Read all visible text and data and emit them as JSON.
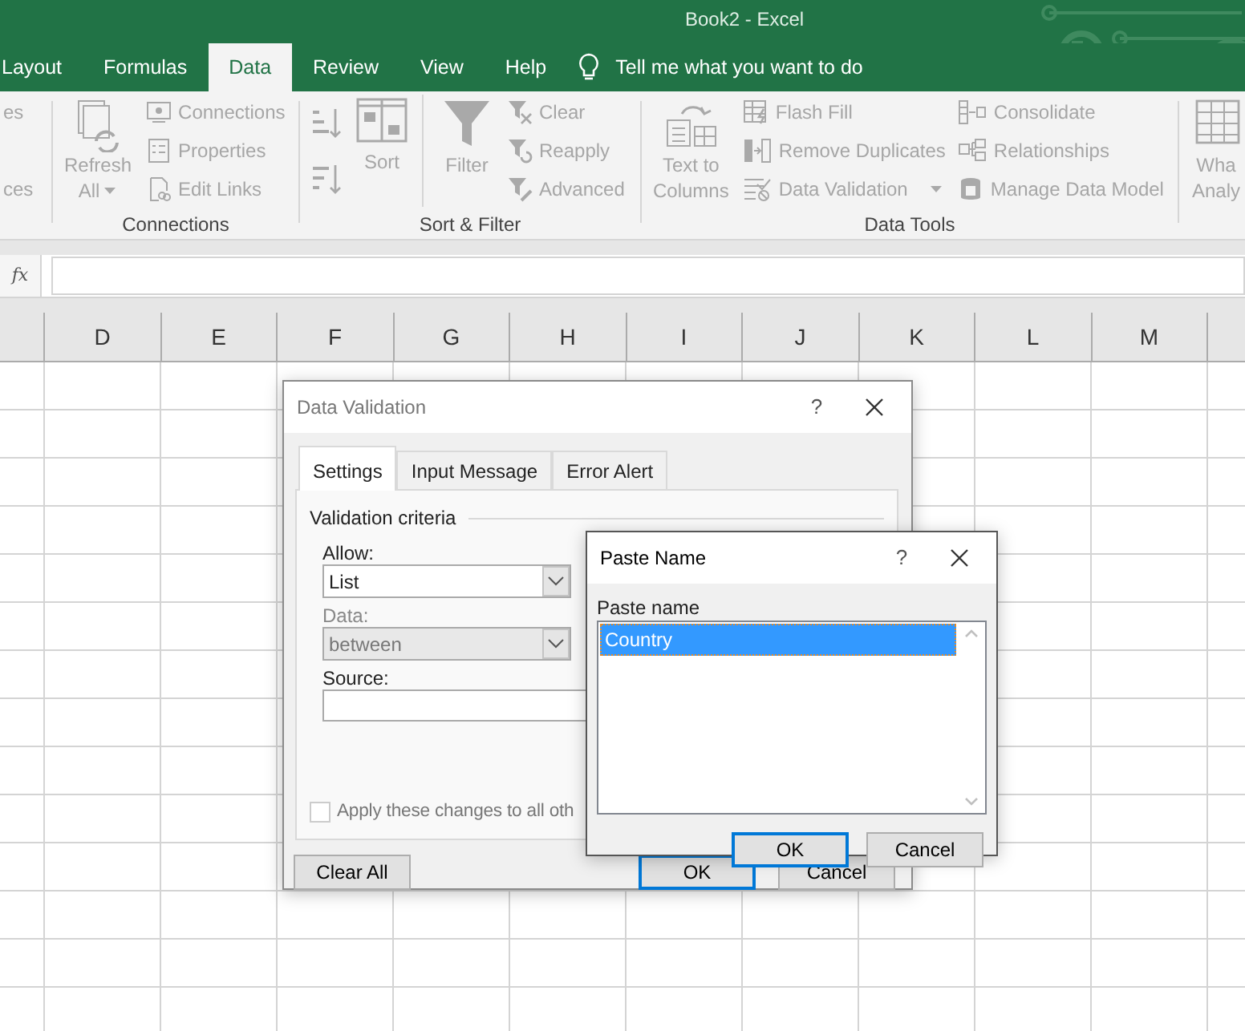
{
  "window": {
    "title": "Book2  -  Excel"
  },
  "ribbon_tabs": [
    {
      "label": "Layout",
      "selected": false
    },
    {
      "label": "Formulas",
      "selected": false
    },
    {
      "label": "Data",
      "selected": true
    },
    {
      "label": "Review",
      "selected": false
    },
    {
      "label": "View",
      "selected": false
    },
    {
      "label": "Help",
      "selected": false
    }
  ],
  "tell_me": {
    "label": "Tell me what you want to do"
  },
  "ribbon": {
    "disabled": true,
    "groups": [
      {
        "columns": [
          [
            {
              "kind": "small",
              "label": "es"
            },
            {
              "kind": "small",
              "label": "ces"
            }
          ]
        ]
      },
      {
        "label": "Connections",
        "columns": [
          [
            {
              "kind": "large",
              "lines": [
                "Refresh",
                "All"
              ],
              "dropdown": true
            }
          ],
          [
            {
              "kind": "small",
              "label": "Connections"
            },
            {
              "kind": "small",
              "label": "Properties"
            },
            {
              "kind": "small",
              "label": "Edit Links"
            }
          ]
        ]
      },
      {
        "label": "Sort & Filter",
        "columns": [
          [
            {
              "kind": "icon"
            },
            {
              "kind": "icon"
            }
          ],
          [
            {
              "kind": "large",
              "lines": [
                "Sort"
              ]
            }
          ],
          [
            {
              "kind": "large",
              "lines": [
                "Filter"
              ]
            }
          ],
          [
            {
              "kind": "small",
              "label": "Clear"
            },
            {
              "kind": "small",
              "label": "Reapply"
            },
            {
              "kind": "small",
              "label": "Advanced"
            }
          ]
        ]
      },
      {
        "label": "Data Tools",
        "columns": [
          [
            {
              "kind": "large",
              "lines": [
                "Text to",
                "Columns"
              ]
            }
          ],
          [
            {
              "kind": "small",
              "label": "Flash Fill"
            },
            {
              "kind": "small",
              "label": "Remove Duplicates"
            },
            {
              "kind": "small",
              "label": "Data Validation",
              "dropdown": true
            }
          ],
          [
            {
              "kind": "small",
              "label": "Consolidate"
            },
            {
              "kind": "small",
              "label": "Relationships"
            },
            {
              "kind": "small",
              "label": "Manage Data Model"
            }
          ]
        ]
      },
      {
        "columns": [
          [
            {
              "kind": "large",
              "lines": [
                "Wha",
                "Analy"
              ]
            }
          ]
        ]
      }
    ]
  },
  "formula_bar": {
    "function_label": "fx"
  },
  "columns": [
    "D",
    "E",
    "F",
    "G",
    "H",
    "I",
    "J",
    "K",
    "L",
    "M"
  ],
  "data_validation": {
    "title": "Data Validation",
    "help": "?",
    "tabs": [
      {
        "label": "Settings",
        "selected": true
      },
      {
        "label": "Input Message",
        "selected": false
      },
      {
        "label": "Error Alert",
        "selected": false
      }
    ],
    "section": "Validation criteria",
    "fields": [
      {
        "kind": "select",
        "label": "Allow:",
        "value": "List",
        "disabled": false
      },
      {
        "kind": "select",
        "label": "Data:",
        "value": "between",
        "disabled": true
      },
      {
        "kind": "text",
        "label": "Source:"
      }
    ],
    "checkbox": {
      "label": "Apply these changes to all oth",
      "checked": false
    },
    "buttons": [
      {
        "label": "Clear All",
        "default": false
      },
      {
        "label": "OK",
        "default": true
      },
      {
        "label": "Cancel",
        "default": false
      }
    ]
  },
  "paste_name": {
    "title": "Paste Name",
    "help": "?",
    "list_label": "Paste name",
    "items": [
      {
        "label": "Country",
        "selected": true
      }
    ],
    "buttons": [
      {
        "label": "OK",
        "default": true
      },
      {
        "label": "Cancel",
        "default": false
      }
    ]
  }
}
